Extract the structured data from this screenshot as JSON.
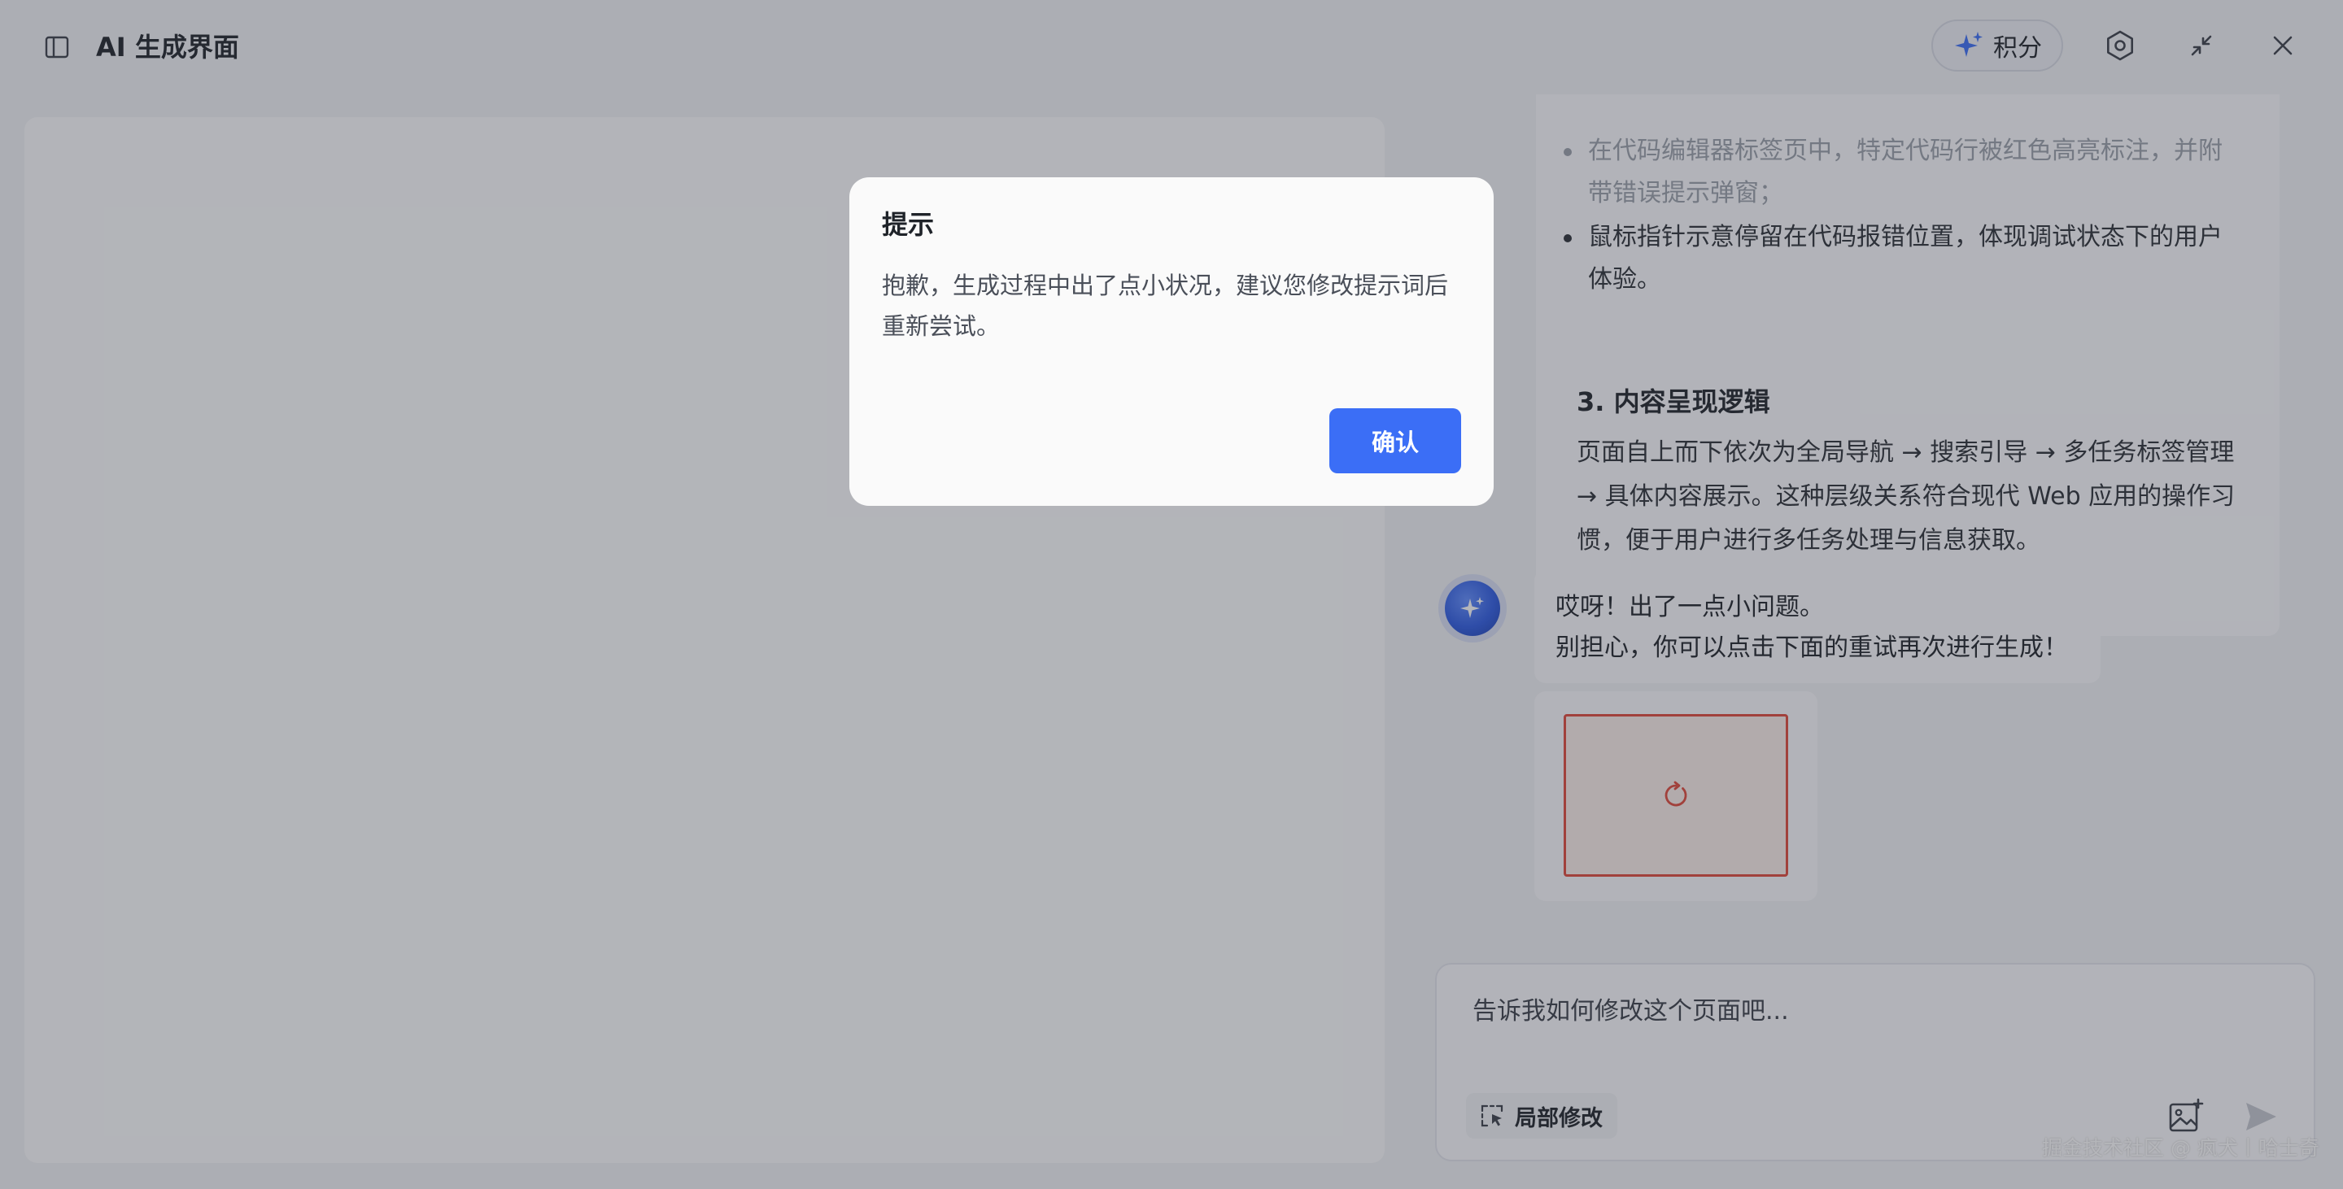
{
  "header": {
    "title": "AI 生成界面",
    "credits_label": "积分"
  },
  "chat": {
    "bullets": [
      "在代码编辑器标签页中，特定代码行被红色高亮标注，并附带错误提示弹窗；",
      "鼠标指针示意停留在代码报错位置，体现调试状态下的用户体验。"
    ],
    "section_heading": "3. 内容呈现逻辑",
    "section_body": "页面自上而下依次为全局导航 → 搜索引导 → 多任务标签管理 → 具体内容展示。这种层级关系符合现代 Web 应用的操作习惯，便于用户进行多任务处理与信息获取。",
    "error_message": {
      "line1": "哎呀！出了一点小问题。",
      "line2": "别担心，你可以点击下面的重试再次进行生成！"
    }
  },
  "input": {
    "placeholder": "告诉我如何修改这个页面吧...",
    "local_edit_label": "局部修改"
  },
  "watermark": "掘金技术社区 @ 疯犬丨哈士奇",
  "modal": {
    "title": "提示",
    "body": "抱歉，生成过程中出了点小状况，建议您修改提示词后重新尝试。",
    "confirm_label": "确认"
  },
  "colors": {
    "accent": "#3b6ef6",
    "error": "#e0483a"
  }
}
